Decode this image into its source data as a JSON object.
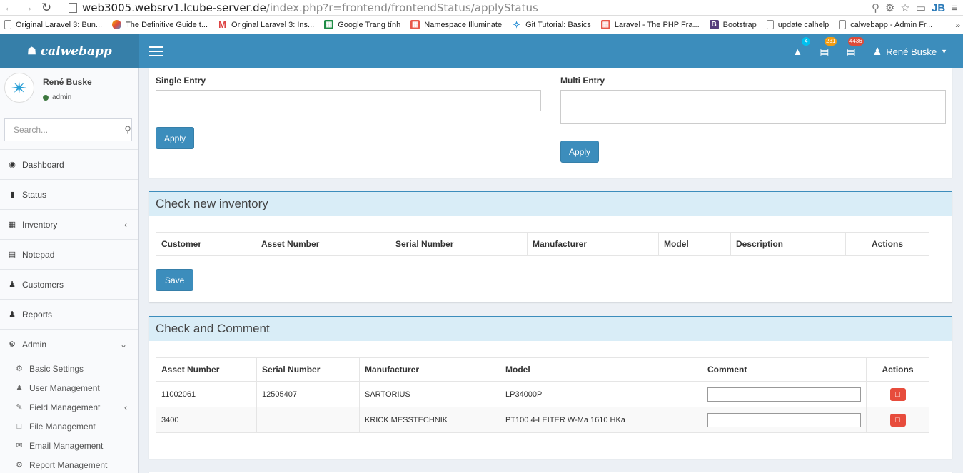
{
  "browser": {
    "url_host": "web3005.websrv1.lcube-server.de",
    "url_path": "/index.php?r=frontend/frontendStatus/applyStatus",
    "ext_label": "JB",
    "bookmarks": [
      {
        "label": "Original Laravel 3: Bun...",
        "icon": "doc"
      },
      {
        "label": "The Definitive Guide t...",
        "icon": "yii"
      },
      {
        "label": "Original Laravel 3: Ins...",
        "icon": "gmail"
      },
      {
        "label": "Google Trang tính",
        "icon": "sheets"
      },
      {
        "label": "Namespace Illuminate",
        "icon": "laravel"
      },
      {
        "label": "Git Tutorial: Basics",
        "icon": "git"
      },
      {
        "label": "Laravel - The PHP Fra...",
        "icon": "laravel"
      },
      {
        "label": "Bootstrap",
        "icon": "bootstrap"
      },
      {
        "label": "update calhelp",
        "icon": "doc"
      },
      {
        "label": "calwebapp - Admin Fr...",
        "icon": "doc"
      }
    ]
  },
  "header": {
    "brand": "calwebapp",
    "notif_alert_count": "4",
    "notif_tasks_count": "231",
    "notif_messages_count": "4436",
    "user_name": "René Buske"
  },
  "sidebar": {
    "user_name": "René Buske",
    "user_role": "admin",
    "search_placeholder": "Search...",
    "items": [
      {
        "label": "Dashboard"
      },
      {
        "label": "Status"
      },
      {
        "label": "Inventory"
      },
      {
        "label": "Notepad"
      },
      {
        "label": "Customers"
      },
      {
        "label": "Reports"
      },
      {
        "label": "Admin"
      }
    ],
    "admin_sub": [
      {
        "label": "Basic Settings"
      },
      {
        "label": "User Management"
      },
      {
        "label": "Field Management"
      },
      {
        "label": "File Management"
      },
      {
        "label": "Email Management"
      },
      {
        "label": "Report Management"
      }
    ]
  },
  "entry": {
    "single_label": "Single Entry",
    "multi_label": "Multi Entry",
    "apply_label": "Apply"
  },
  "check_new": {
    "title": "Check new inventory",
    "columns": [
      "Customer",
      "Asset Number",
      "Serial Number",
      "Manufacturer",
      "Model",
      "Description",
      "Actions"
    ],
    "save_label": "Save"
  },
  "check_comment": {
    "title": "Check and Comment",
    "columns": [
      "Asset Number",
      "Serial Number",
      "Manufacturer",
      "Model",
      "Comment",
      "Actions"
    ],
    "rows": [
      {
        "asset": "11002061",
        "serial": "12505407",
        "manufacturer": "SARTORIUS",
        "model": "LP34000P"
      },
      {
        "asset": "3400",
        "serial": "",
        "manufacturer": "KRICK MESSTECHNIK",
        "model": "PT100 4-LEITER W-Ma 1610 HKa"
      }
    ]
  }
}
